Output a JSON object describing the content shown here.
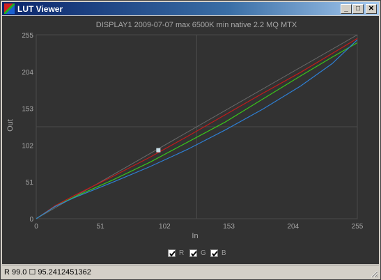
{
  "window": {
    "title": "LUT Viewer",
    "buttons": {
      "minimize": "_",
      "maximize": "□",
      "close": "✕"
    }
  },
  "chart_data": {
    "type": "line",
    "title": "DISPLAY1 2009-07-07 max 6500K min native 2.2 MQ MTX",
    "xlabel": "In",
    "ylabel": "Out",
    "xlim": [
      0,
      255
    ],
    "ylim": [
      0,
      255
    ],
    "xticks": [
      "0",
      "51",
      "102",
      "153",
      "204",
      "255"
    ],
    "yticks": [
      "0",
      "51",
      "102",
      "153",
      "204",
      "255"
    ],
    "grid": true,
    "crosshair": {
      "x": 127.5,
      "y": 127.5
    },
    "reference_line": {
      "from": [
        0,
        0
      ],
      "to": [
        255,
        255
      ]
    },
    "series": [
      {
        "name": "R",
        "color": "#c41a1a",
        "x": [
          0,
          15,
          30,
          60,
          90,
          120,
          150,
          180,
          210,
          235,
          255
        ],
        "y": [
          0,
          18,
          32,
          58,
          85,
          114,
          144,
          174,
          203,
          229,
          250
        ]
      },
      {
        "name": "G",
        "color": "#39c41a",
        "x": [
          0,
          15,
          30,
          60,
          90,
          120,
          150,
          180,
          210,
          235,
          255
        ],
        "y": [
          0,
          17,
          30,
          53,
          78,
          106,
          134,
          166,
          198,
          224,
          244
        ]
      },
      {
        "name": "B",
        "color": "#2e7fd4",
        "x": [
          0,
          15,
          30,
          60,
          90,
          120,
          150,
          180,
          210,
          235,
          255
        ],
        "y": [
          0,
          17,
          29,
          50,
          72,
          96,
          123,
          152,
          184,
          215,
          248
        ]
      }
    ],
    "marker": {
      "x": 97,
      "y": 95,
      "color": "#c8dfe8"
    },
    "legend": [
      {
        "label": "R",
        "checked": true
      },
      {
        "label": "G",
        "checked": true
      },
      {
        "label": "B",
        "checked": true
      }
    ]
  },
  "status": {
    "text": "R 99.0 ☐ 95.2412451362"
  }
}
